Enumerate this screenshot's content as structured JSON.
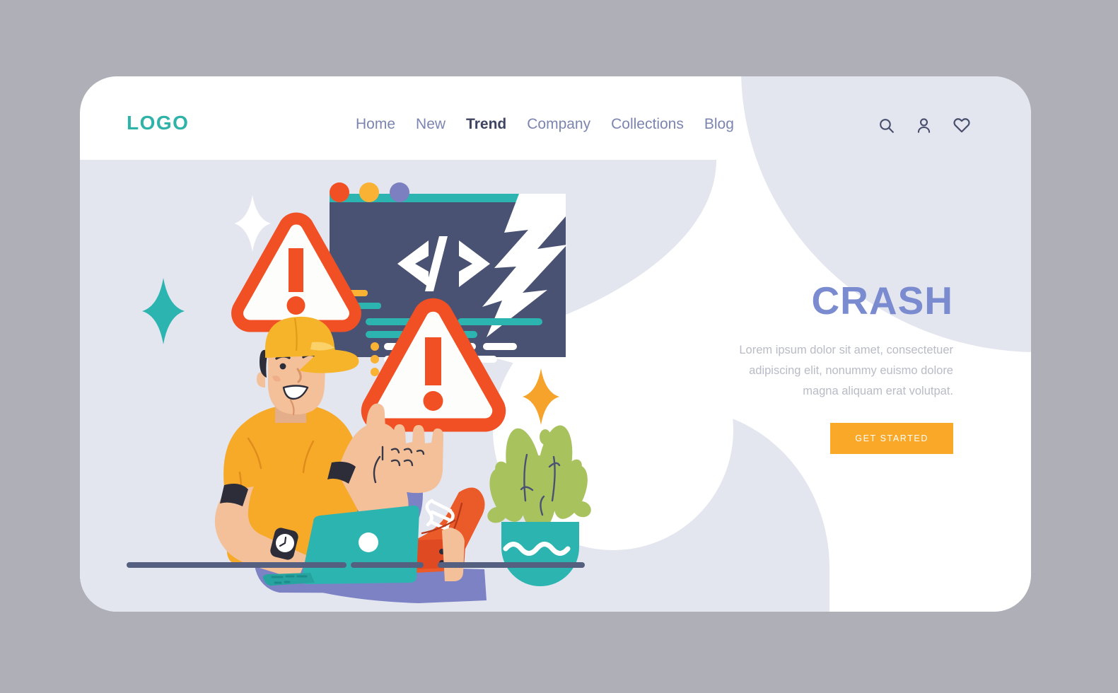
{
  "page": {
    "background_color": "#AFAFB8",
    "card_background": "#FFFFFF",
    "blob_color": "#E3E5EF"
  },
  "header": {
    "logo": "LOGO",
    "logo_color": "#2FB3A8",
    "nav": [
      {
        "label": "Home",
        "active": false
      },
      {
        "label": "New",
        "active": false
      },
      {
        "label": "Trend",
        "active": true
      },
      {
        "label": "Company",
        "active": false
      },
      {
        "label": "Collections",
        "active": false
      },
      {
        "label": "Blog",
        "active": false
      }
    ],
    "icons": [
      {
        "name": "search-icon"
      },
      {
        "name": "user-icon"
      },
      {
        "name": "heart-icon"
      }
    ]
  },
  "hero": {
    "title": "CRASH",
    "title_color": "#7B8BD0",
    "paragraph": "Lorem ipsum dolor sit amet, consectetuer adipiscing elit, nonummy euismo dolore magna aliquam erat volutpat.",
    "paragraph_color": "#B9BBC6",
    "cta_label": "GET STARTED",
    "cta_color": "#F9A828"
  },
  "illustration": {
    "code_window": {
      "body_color": "#4A5273",
      "title_bar_color": "#2CB5B0",
      "code_glyph": "</>",
      "dots": [
        {
          "name": "dot-red",
          "color": "#F05024"
        },
        {
          "name": "dot-amber",
          "color": "#F9B233"
        },
        {
          "name": "dot-purple",
          "color": "#7C7FC0"
        }
      ],
      "crack_color": "#FFFFFF",
      "line_colors": [
        "#2CB5B0",
        "#F9B233",
        "#FFFFFF"
      ]
    },
    "warning_triangles": {
      "count": 2,
      "stroke_color": "#F05024",
      "fill_color": "#FDFDFB"
    },
    "character": {
      "cap_color": "#F6B42B",
      "shirt_color": "#F7A928",
      "skin_color": "#F3C09A",
      "jeans_color": "#7C82C4",
      "shoe_color": "#EB5B2A",
      "watch_color": "#2D2D3A",
      "laptop_color": "#2CB5B0"
    },
    "plant": {
      "pot_color": "#2CB5B0",
      "pot_pattern_color": "#FFFFFF",
      "leaf_color": "#A8C25E",
      "leaf_dark_color": "#8FAE4E"
    },
    "sparkles": [
      {
        "name": "sparkle-white",
        "color": "#FFFFFF"
      },
      {
        "name": "sparkle-teal",
        "color": "#2CB5B0"
      },
      {
        "name": "sparkle-amber",
        "color": "#F6A32B"
      }
    ],
    "ground_line_color": "#555F7F"
  }
}
